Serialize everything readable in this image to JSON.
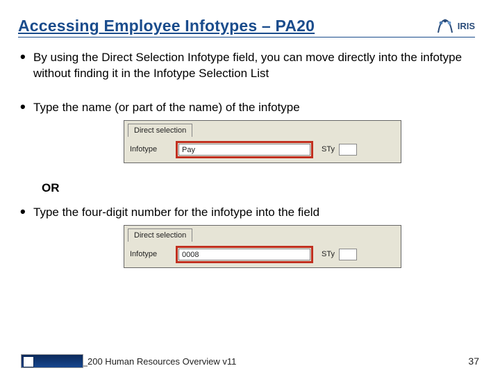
{
  "header": {
    "title": "Accessing Employee Infotypes – PA20",
    "logo_text": "IRIS"
  },
  "bullets": {
    "b1": "By using the Direct Selection Infotype field, you can move directly into the infotype without finding it in the Infotype Selection List",
    "b2": "Type the name (or part of the name) of the infotype",
    "b3": "Type the four-digit number for the infotype into the field"
  },
  "or_label": "OR",
  "sap_box": {
    "tab_label": "Direct selection",
    "infotype_label": "Infotype",
    "sty_label": "STy",
    "value_text": "Pay",
    "value_code": "0008"
  },
  "footer": {
    "course": "HR_200 Human Resources Overview v11",
    "page": "37"
  }
}
